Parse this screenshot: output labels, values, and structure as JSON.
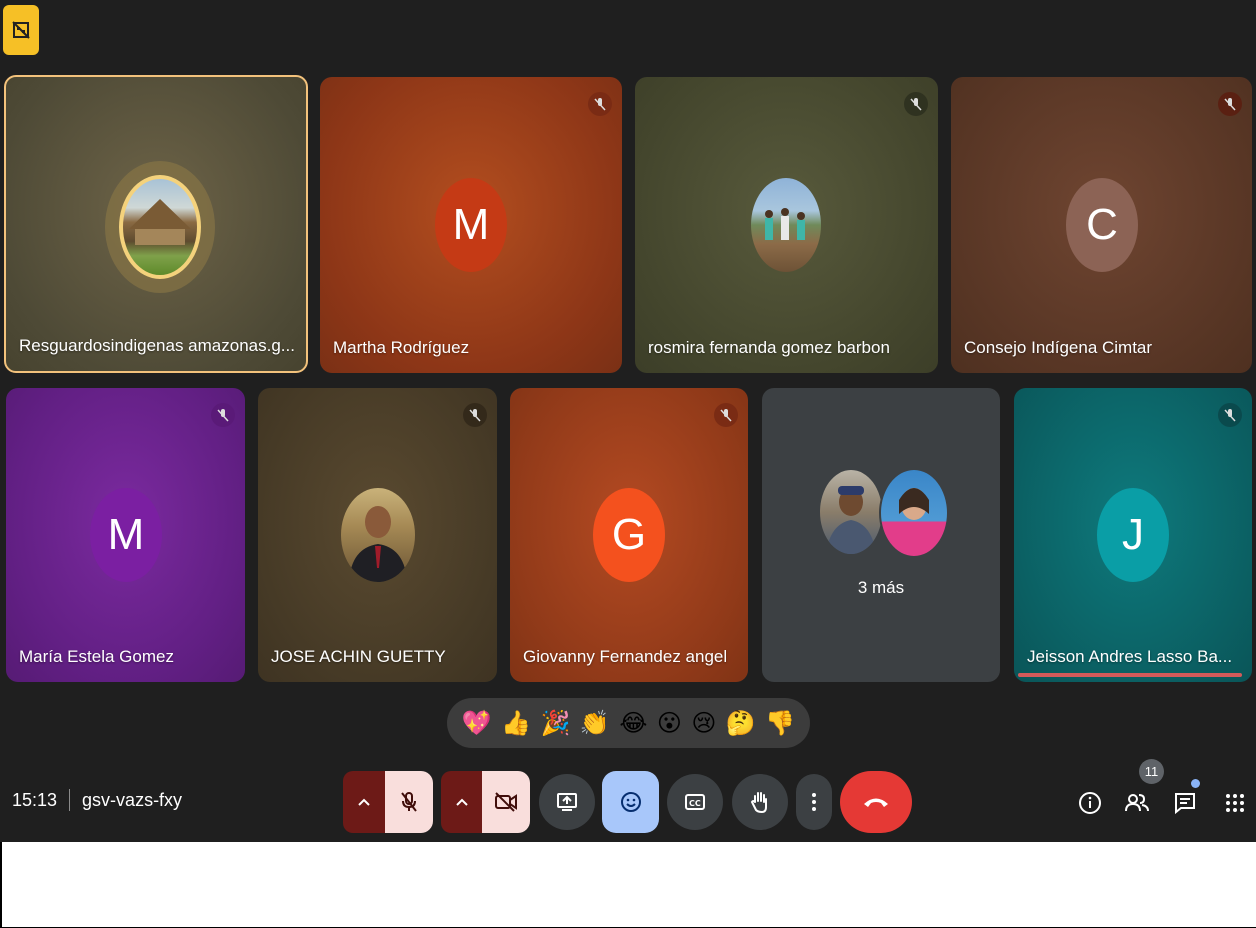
{
  "participants": [
    {
      "name": "Resguardosindigenas amazonas.g..."
    },
    {
      "name": "Martha Rodríguez",
      "initial": "M"
    },
    {
      "name": "rosmira fernanda gomez barbon"
    },
    {
      "name": "Consejo Indígena Cimtar",
      "initial": "C"
    },
    {
      "name": "María Estela Gomez",
      "initial": "M"
    },
    {
      "name": "JOSE ACHIN GUETTY"
    },
    {
      "name": "Giovanny Fernandez angel",
      "initial": "G"
    },
    {
      "name": "Jeisson Andres Lasso Ba...",
      "initial": "J"
    }
  ],
  "more_label": "3 más",
  "reactions": [
    "💖",
    "👍",
    "🎉",
    "👏",
    "😂",
    "😮",
    "😢",
    "🤔",
    "👎"
  ],
  "footer": {
    "time": "15:13",
    "meeting_code": "gsv-vazs-fxy",
    "people_count": "11"
  },
  "icons": [
    "no-recording-icon",
    "mic-off-icon",
    "camera-off-icon",
    "present-icon",
    "emoji-icon",
    "captions-icon",
    "raise-hand-icon",
    "more-icon",
    "end-call-icon",
    "info-icon",
    "people-icon",
    "chat-icon",
    "apps-icon"
  ],
  "colors": {
    "end_call": "#e53935",
    "muted_button": "#f9dedc",
    "emoji_button": "#a8c7fa",
    "active_speaker": "#f3c27c"
  }
}
